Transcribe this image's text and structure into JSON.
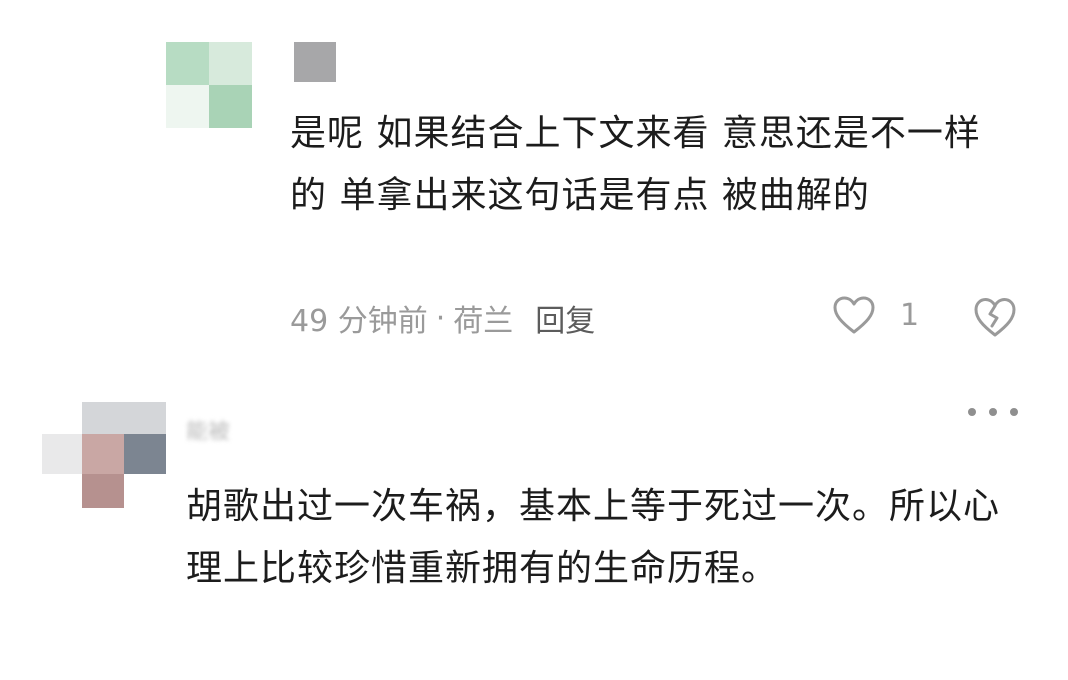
{
  "reply": {
    "text": "是呢 如果结合上下文来看 意思还是不一样的 单拿出来这句话是有点 被曲解的",
    "time": "49 分钟前",
    "separator": "·",
    "location": "荷兰",
    "reply_label": "回复",
    "like_count": "1"
  },
  "top_comment": {
    "username": "能被",
    "text": "胡歌出过一次车祸，基本上等于死过一次。所以心理上比较珍惜重新拥有的生命历程。"
  },
  "icons": {
    "like": "heart-icon",
    "dislike": "broken-heart-icon",
    "more": "more-dots-icon"
  },
  "colors": {
    "meta_text": "#9a9a9a",
    "body_text": "#1c1c1c"
  }
}
